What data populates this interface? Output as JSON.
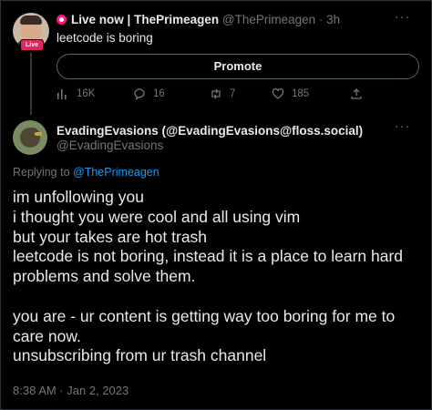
{
  "tweet1": {
    "live_label": "Live now",
    "separator": "|",
    "author_name": "ThePrimeagen",
    "handle": "@ThePrimeagen",
    "time": "· 3h",
    "text": "leetcode is boring",
    "live_badge": "Live",
    "promote_label": "Promote",
    "stats": {
      "views": "16K",
      "replies": "16",
      "retweets": "7",
      "likes": "185"
    },
    "icons": {
      "views": "bar-chart-icon",
      "replies": "reply-icon",
      "retweets": "retweet-icon",
      "likes": "heart-icon",
      "share": "share-icon"
    }
  },
  "tweet2": {
    "display_name": "EvadingEvasions (@EvadingEvasions@floss.social)",
    "handle": "@EvadingEvasions",
    "replying_prefix": "Replying to",
    "replying_to": "@ThePrimeagen",
    "body": "im unfollowing you\ni thought you were cool and all using vim\nbut your takes are hot trash\nleetcode is not boring, instead it is a place to learn hard problems and solve them.\n\nyou are - ur content is getting way too boring for me to care now.\nunsubscribing from ur trash channel",
    "timestamp": "8:38 AM · Jan 2, 2023"
  },
  "more_icon": "···",
  "colors": {
    "background": "#000000",
    "text": "#e7e9ea",
    "muted": "#71767b",
    "link": "#1d9bf0",
    "live": "#f91880"
  }
}
